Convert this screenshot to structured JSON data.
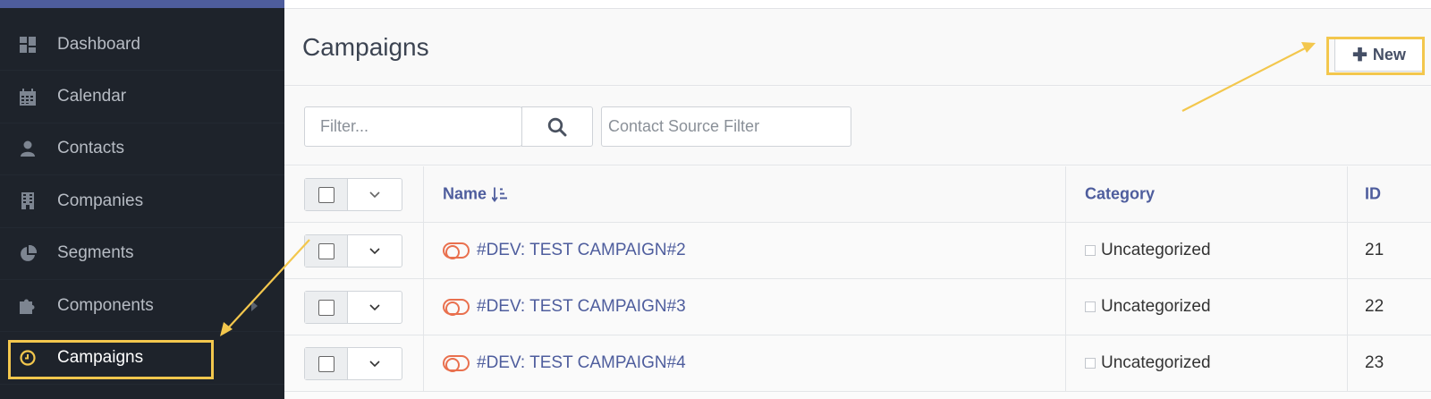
{
  "sidebar": {
    "items": [
      {
        "label": "Dashboard",
        "icon": "dashboard-icon"
      },
      {
        "label": "Calendar",
        "icon": "calendar-icon"
      },
      {
        "label": "Contacts",
        "icon": "user-icon"
      },
      {
        "label": "Companies",
        "icon": "building-icon"
      },
      {
        "label": "Segments",
        "icon": "pie-chart-icon"
      },
      {
        "label": "Components",
        "icon": "puzzle-icon"
      },
      {
        "label": "Campaigns",
        "icon": "clock-icon"
      }
    ]
  },
  "header": {
    "title": "Campaigns",
    "new_label": "New",
    "new_icon": "plus-icon"
  },
  "filters": {
    "filter_placeholder": "Filter...",
    "search_icon": "search-icon",
    "source_placeholder": "Contact Source Filter"
  },
  "table": {
    "columns": {
      "name": "Name",
      "category": "Category",
      "id": "ID"
    },
    "rows": [
      {
        "name": "#DEV: TEST CAMPAIGN#2",
        "category": "Uncategorized",
        "id": "21"
      },
      {
        "name": "#DEV: TEST CAMPAIGN#3",
        "category": "Uncategorized",
        "id": "22"
      },
      {
        "name": "#DEV: TEST CAMPAIGN#4",
        "category": "Uncategorized",
        "id": "23"
      }
    ]
  },
  "colors": {
    "sidebar_bg": "#1e232b",
    "accent": "#4e5d9d",
    "highlight": "#f3c74d",
    "toggle": "#e9704e"
  }
}
